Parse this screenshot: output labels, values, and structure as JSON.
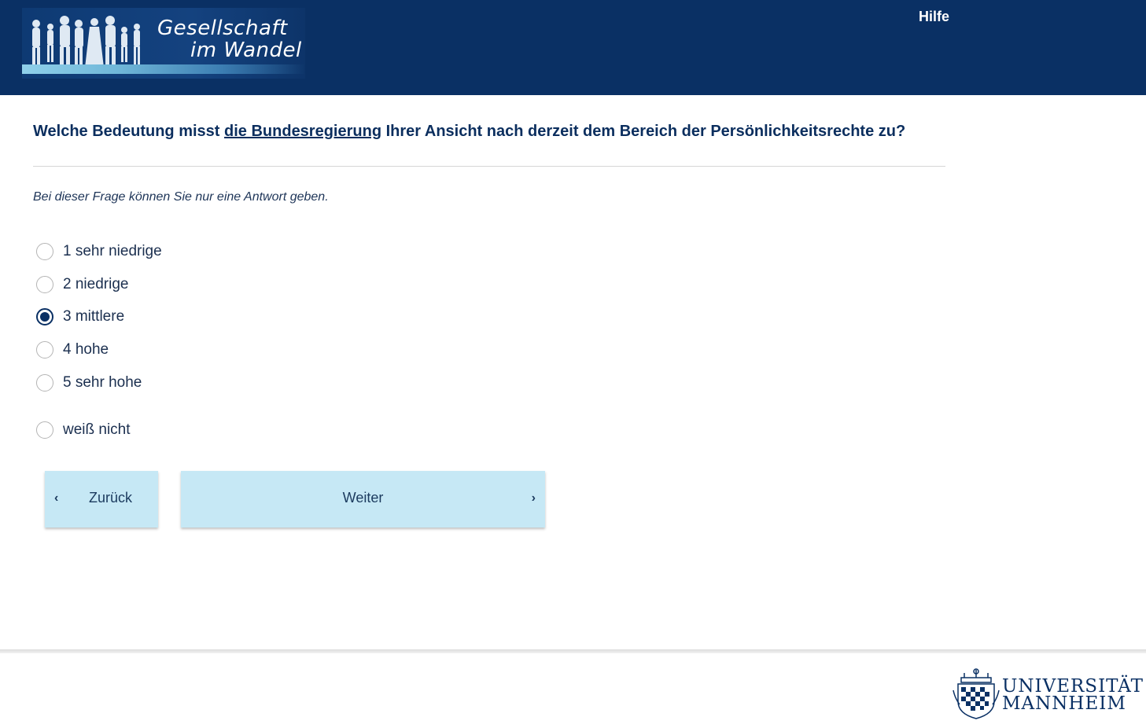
{
  "header": {
    "logo_line1": "Gesellschaft",
    "logo_line2": "im Wandel",
    "help_label": "Hilfe"
  },
  "question": {
    "text_before": "Welche Bedeutung misst ",
    "text_underlined": "die Bundesregierung",
    "text_after": " Ihrer Ansicht nach derzeit dem Bereich der Persönlichkeitsrechte zu?",
    "instruction": "Bei dieser Frage können Sie nur eine Antwort geben."
  },
  "options": [
    {
      "label": "1 sehr niedrige",
      "checked": false
    },
    {
      "label": "2 niedrige",
      "checked": false
    },
    {
      "label": "3 mittlere",
      "checked": true
    },
    {
      "label": "4 hohe",
      "checked": false
    },
    {
      "label": "5 sehr hohe",
      "checked": false
    },
    {
      "label": "weiß nicht",
      "checked": false
    }
  ],
  "navigation": {
    "back_label": "Zurück",
    "next_label": "Weiter"
  },
  "footer": {
    "university_line1": "UNIVERSITÄT",
    "university_line2": "MANNHEIM"
  },
  "colors": {
    "header_bg": "#0a3064",
    "button_bg": "#c6e8f5",
    "text": "#0b2e5e"
  }
}
